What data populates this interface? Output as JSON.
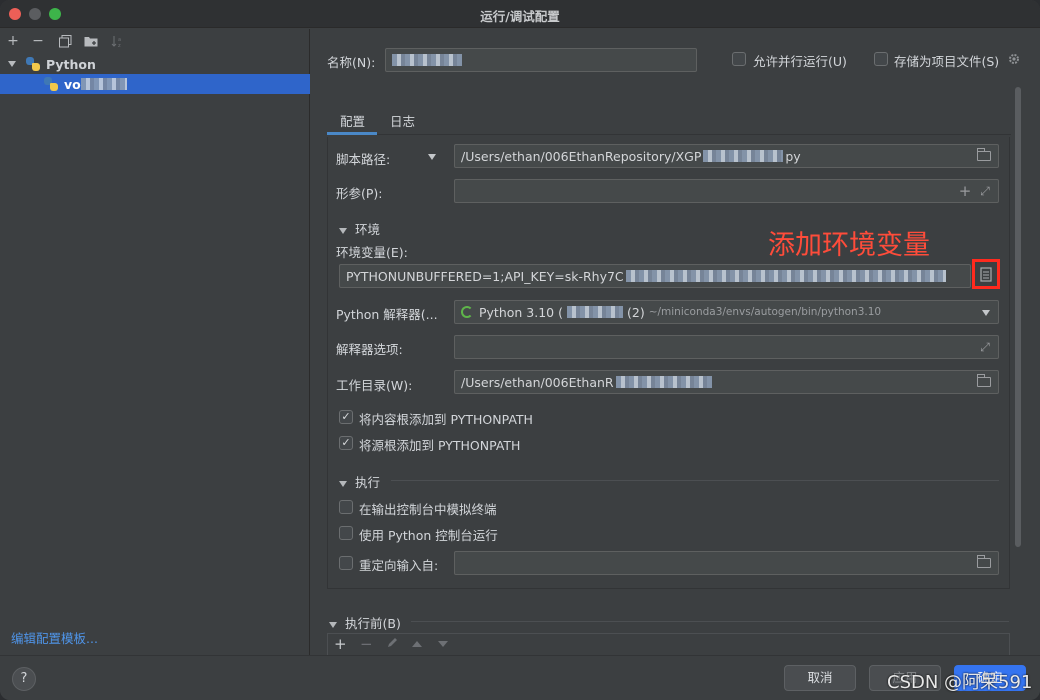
{
  "window": {
    "title": "运行/调试配置"
  },
  "left": {
    "toolbar": {
      "add": "+",
      "remove": "−",
      "copy_icon": "copy-icon",
      "folder_icon": "folder-add-icon",
      "sort_icon": "sort-icon"
    },
    "tree": {
      "group_label": "Python",
      "item_label": "vo"
    },
    "edit_templates": "编辑配置模板..."
  },
  "right": {
    "name_label": "名称(N):",
    "allow_parallel": "允许并行运行(U)",
    "store_as_project": "存储为项目文件(S)",
    "tabs": [
      "配置",
      "日志"
    ],
    "script_path_label": "脚本路径:",
    "script_path_value": "/Users/ethan/006EthanRepository/XGP",
    "script_path_suffix": "py",
    "params_label": "形参(P):",
    "env_section": "环境",
    "env_vars_label": "环境变量(E):",
    "env_vars_value": "PYTHONUNBUFFERED=1;API_KEY=sk-Rhy7C",
    "interpreter_label": "Python 解释器(...",
    "interpreter_value": "Python 3.10 (",
    "interpreter_suffix": "(2)",
    "interpreter_path": "~/miniconda3/envs/autogen/bin/python3.10",
    "interpreter_options_label": "解释器选项:",
    "workdir_label": "工作目录(W):",
    "workdir_value": "/Users/ethan/006EthanR",
    "add_content_roots": "将内容根添加到 PYTHONPATH",
    "add_source_roots": "将源根添加到 PYTHONPATH",
    "exec_section": "执行",
    "emulate_terminal": "在输出控制台中模拟终端",
    "use_python_console": "使用 Python 控制台运行",
    "redirect_input": "重定向输入自:",
    "before_launch": "执行前(B)",
    "annotation": "添加环境变量"
  },
  "buttons": {
    "cancel": "取消",
    "apply": "应用",
    "ok": "确定",
    "help": "?"
  },
  "watermark": "CSDN @阿呆591"
}
